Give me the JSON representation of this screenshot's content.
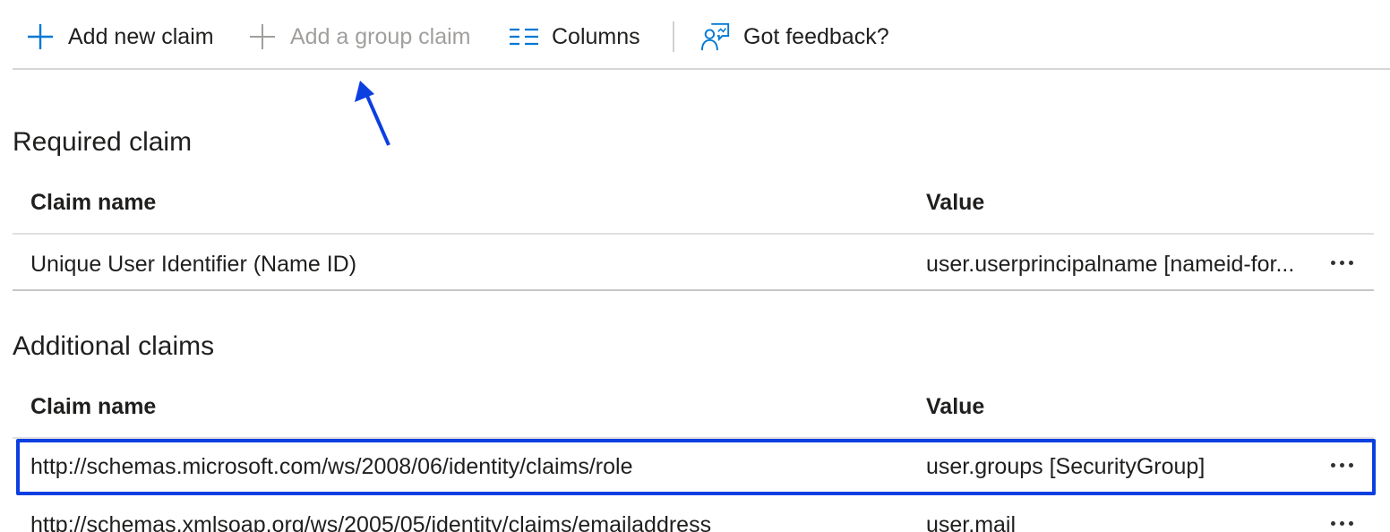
{
  "toolbar": {
    "add_new_claim": "Add new claim",
    "add_group_claim": "Add a group claim",
    "columns": "Columns",
    "feedback": "Got feedback?"
  },
  "required": {
    "title": "Required claim",
    "col_name": "Claim name",
    "col_value": "Value",
    "rows": [
      {
        "name": "Unique User Identifier (Name ID)",
        "value": "user.userprincipalname [nameid-for..."
      }
    ]
  },
  "additional": {
    "title": "Additional claims",
    "col_name": "Claim name",
    "col_value": "Value",
    "rows": [
      {
        "name": "http://schemas.microsoft.com/ws/2008/06/identity/claims/role",
        "value": "user.groups [SecurityGroup]"
      },
      {
        "name": "http://schemas.xmlsoap.org/ws/2005/05/identity/claims/emailaddress",
        "value": "user.mail"
      }
    ]
  },
  "colors": {
    "accent": "#0078d4",
    "highlight": "#0b3fe0",
    "disabled_text": "#a19f9d"
  },
  "icons": [
    "plus-icon",
    "plus-icon-disabled",
    "columns-icon",
    "feedback-icon",
    "more-icon",
    "arrow-annotation"
  ]
}
